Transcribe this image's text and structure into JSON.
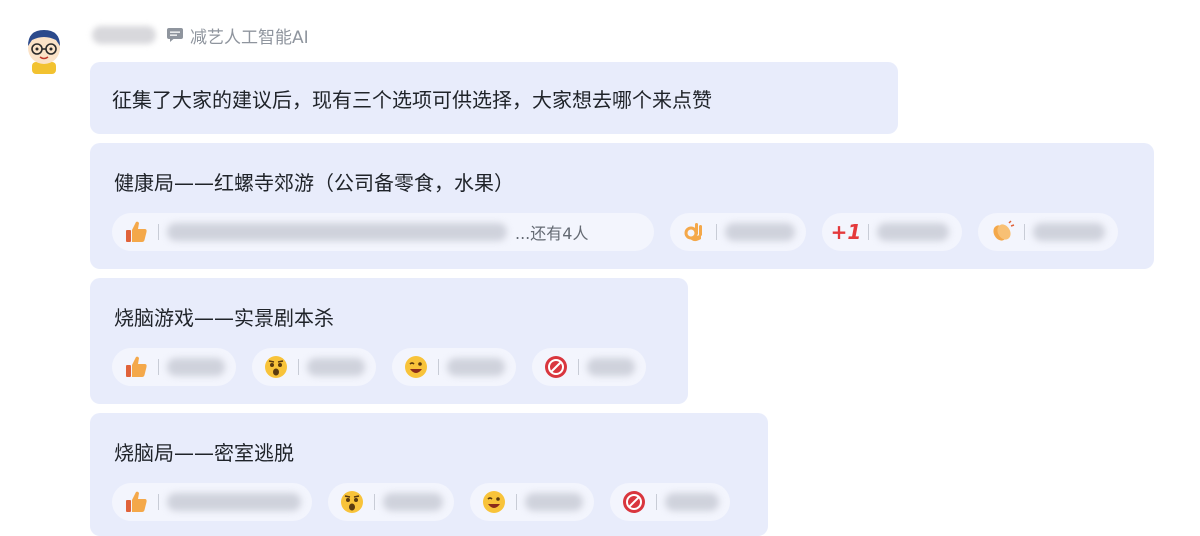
{
  "sender": {
    "group_name": "减艺人工智能AI"
  },
  "messages": [
    {
      "text": "征集了大家的建议后，现有三个选项可供选择，大家想去哪个来点赞"
    },
    {
      "text": "健康局——红螺寺郊游（公司备零食，水果）",
      "reactions": [
        {
          "emoji": "thumbs-up",
          "more": "...还有4人"
        },
        {
          "emoji": "ok-hand"
        },
        {
          "emoji": "plus-one",
          "label": "+1"
        },
        {
          "emoji": "clapping-hands"
        }
      ]
    },
    {
      "text": "烧脑游戏——实景剧本杀",
      "reactions": [
        {
          "emoji": "thumbs-up"
        },
        {
          "emoji": "surprised-face"
        },
        {
          "emoji": "grinning-face"
        },
        {
          "emoji": "no-sign"
        }
      ]
    },
    {
      "text": "烧脑局——密室逃脱",
      "reactions": [
        {
          "emoji": "thumbs-up"
        },
        {
          "emoji": "surprised-face"
        },
        {
          "emoji": "grinning-face"
        },
        {
          "emoji": "no-sign"
        }
      ]
    }
  ],
  "colors": {
    "bubble": "#e8ecfb",
    "chip": "#f3f5fd",
    "plus_one": "#e4393c",
    "muted": "#8f959e"
  }
}
